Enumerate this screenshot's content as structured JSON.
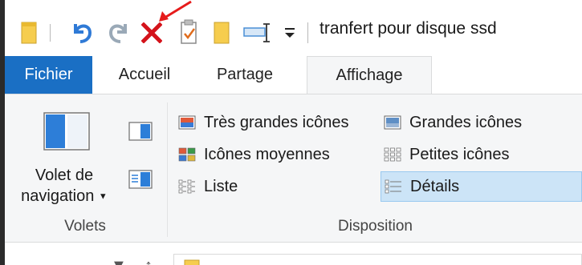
{
  "window": {
    "title": "tranfert pour disque ssd"
  },
  "quick_access": {
    "icons": [
      "properties-folder-icon",
      "undo-icon",
      "redo-icon",
      "delete-icon",
      "checkmark-file-icon",
      "new-folder-icon",
      "rename-icon",
      "customize-dropdown-icon"
    ]
  },
  "tabs": [
    {
      "label": "Fichier"
    },
    {
      "label": "Accueil"
    },
    {
      "label": "Partage"
    },
    {
      "label": "Affichage"
    }
  ],
  "ribbon": {
    "panes": {
      "nav_pane_label_line1": "Volet de",
      "nav_pane_label_line2": "navigation",
      "group_label": "Volets"
    },
    "layout": {
      "items": [
        {
          "label": "Très grandes icônes"
        },
        {
          "label": "Grandes icônes"
        },
        {
          "label": "Icônes moyennes"
        },
        {
          "label": "Petites icônes"
        },
        {
          "label": "Liste"
        },
        {
          "label": "Détails"
        }
      ],
      "selected": "Détails",
      "group_label": "Disposition"
    }
  },
  "colors": {
    "file_tab": "#1a6fc4",
    "selected_bg": "#cce4f7",
    "delete_red": "#d4131b",
    "undo_blue": "#2f7ad6",
    "folder_yellow": "#f6cd4e",
    "annotation_red": "#e61b1b"
  }
}
